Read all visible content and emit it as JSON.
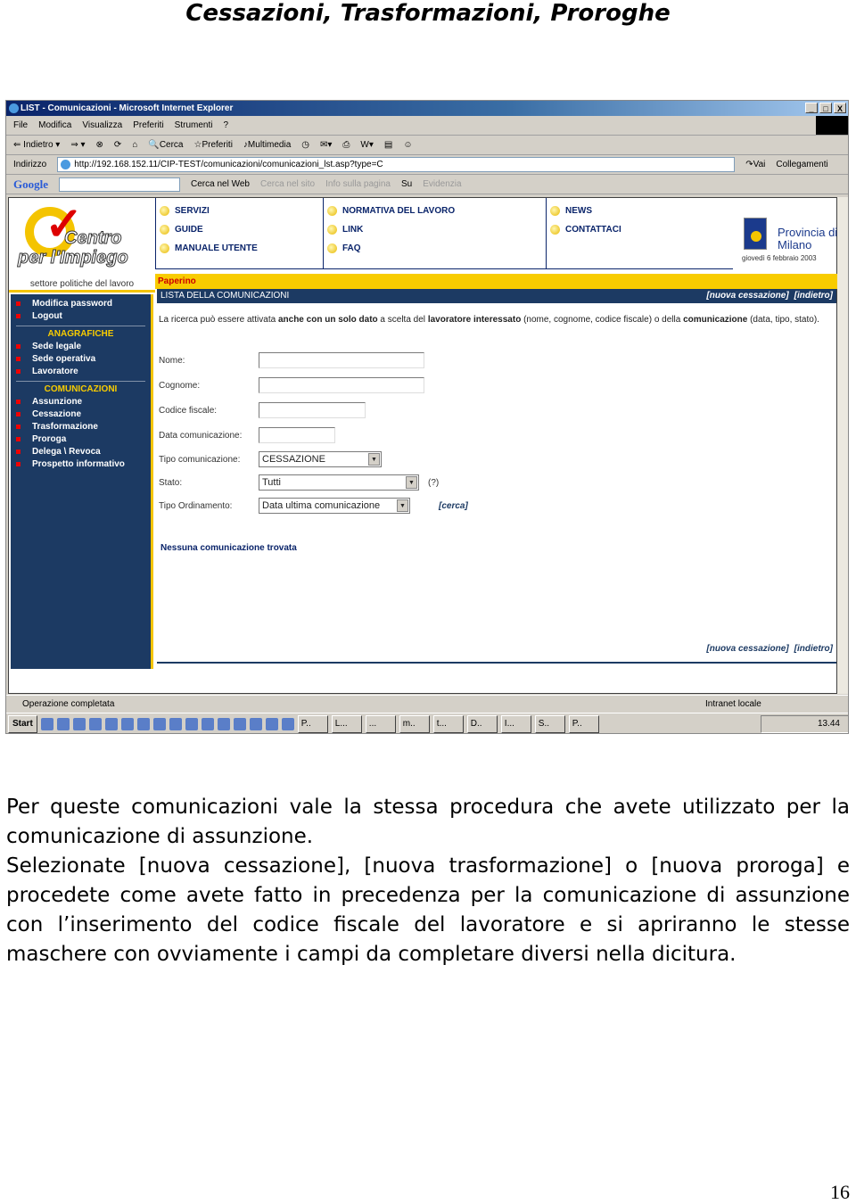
{
  "doc": {
    "title": "Cessazioni, Trasformazioni, Proroghe",
    "page_number": "16",
    "paragraphs": [
      "Per queste comunicazioni vale la stessa procedura che avete utilizzato per la comunicazione di assunzione.",
      "Selezionate [nuova cessazione], [nuova trasformazione] o [nuova proroga] e procedete come avete fatto in precedenza per la comunicazione di assunzione con l’inserimento del codice fiscale del lavoratore e si apriranno le stesse maschere con ovviamente i campi da completare diversi nella dicitura."
    ]
  },
  "browser": {
    "title": "LIST - Comunicazioni - Microsoft Internet Explorer",
    "menu": [
      "File",
      "Modifica",
      "Visualizza",
      "Preferiti",
      "Strumenti",
      "?"
    ],
    "toolbar": [
      "Indietro",
      "Cerca",
      "Preferiti",
      "Multimedia"
    ],
    "address_label": "Indirizzo",
    "url": "http://192.168.152.11/CIP-TEST/comunicazioni/comunicazioni_lst.asp?type=C",
    "go": "Vai",
    "links": "Collegamenti",
    "google": {
      "logo": "Google",
      "items": [
        "Cerca nel Web",
        "Cerca nel sito",
        "Info sulla pagina",
        "Su",
        "Evidenzia"
      ]
    },
    "status": "Operazione completata",
    "zone": "Intranet locale"
  },
  "site": {
    "logo_line1": "Centro",
    "logo_line2": "per l'Impiego",
    "settore": "settore politiche del lavoro",
    "nav": [
      [
        "SERVIZI",
        "GUIDE",
        "MANUALE UTENTE"
      ],
      [
        "NORMATIVA DEL LAVORO",
        "LINK",
        "FAQ"
      ],
      [
        "NEWS",
        "CONTATTACI"
      ]
    ],
    "provincia": "Provincia di Milano",
    "date": "giovedì 6 febbraio 2003",
    "user": "Paperino",
    "section_title": "LISTA DELLA COMUNICAZIONI",
    "link_new": "[nuova cessazione]",
    "link_back": "[indietro]",
    "sidebar": {
      "top": [
        "Modifica password",
        "Logout"
      ],
      "anagrafiche_title": "ANAGRAFICHE",
      "anagrafiche": [
        "Sede legale",
        "Sede operativa",
        "Lavoratore"
      ],
      "comunicazioni_title": "COMUNICAZIONI",
      "comunicazioni": [
        "Assunzione",
        "Cessazione",
        "Trasformazione",
        "Proroga",
        "Delega \\ Revoca",
        "Prospetto informativo"
      ]
    },
    "desc": [
      "La ricerca può essere attivata ",
      "anche con un solo dato",
      " a scelta del ",
      "lavoratore interessato",
      " (nome, cognome, codice fiscale) o della ",
      "comunicazione",
      " (data, tipo, stato)."
    ],
    "form": {
      "nome": "Nome:",
      "cognome": "Cognome:",
      "cf": "Codice fiscale:",
      "data": "Data comunicazione:",
      "tipo": "Tipo comunicazione:",
      "tipo_value": "CESSAZIONE",
      "stato": "Stato:",
      "stato_value": "Tutti",
      "help": "(?)",
      "ord": "Tipo Ordinamento:",
      "ord_value": "Data ultima comunicazione",
      "cerca": "[cerca]"
    },
    "no_results": "Nessuna comunicazione trovata"
  },
  "taskbar": {
    "start": "Start",
    "buttons": [
      "P..",
      "L...",
      "...",
      "m..",
      "t...",
      "D..",
      "I...",
      "S..",
      "P.."
    ],
    "clock": "13.44"
  }
}
